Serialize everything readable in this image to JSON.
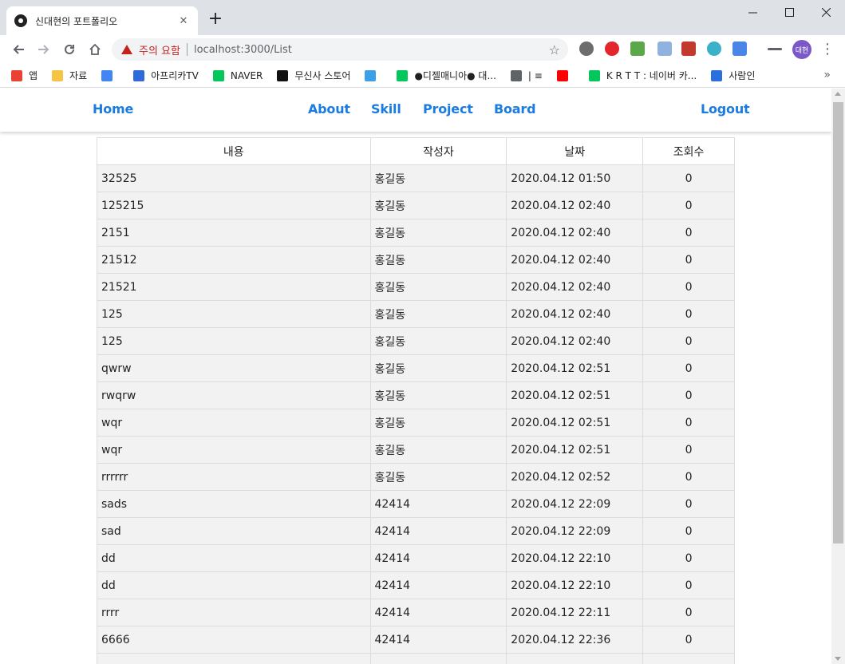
{
  "browser": {
    "tab_title": "신대현의 포트폴리오",
    "tab_close": "✕",
    "new_tab": "+",
    "security_label": "주의 요함",
    "url": "localhost:3000/List",
    "profile": "대현",
    "bookmarks": [
      {
        "label": "앱",
        "icon": "apps-grid-icon",
        "color": "#e94235"
      },
      {
        "label": "자료",
        "icon": "folder-icon",
        "color": "#f6c445"
      },
      {
        "label": "",
        "icon": "google-icon",
        "color": "#4285f4"
      },
      {
        "label": "아프리카TV",
        "icon": "afreecatv-icon",
        "color": "#2f6bd8"
      },
      {
        "label": "NAVER",
        "icon": "naver-icon",
        "color": "#03c75a"
      },
      {
        "label": "무신사 스토어",
        "icon": "musinsa-icon",
        "color": "#111111"
      },
      {
        "label": "",
        "icon": "ondisk-icon",
        "color": "#3aa0e8"
      },
      {
        "label": "●디젤매니아● 대...",
        "icon": "naver-cafe-icon",
        "color": "#03c75a"
      },
      {
        "label": "| ≡",
        "icon": "globe-icon",
        "color": "#5f6368"
      },
      {
        "label": "",
        "icon": "youtube-icon",
        "color": "#ff0000"
      },
      {
        "label": "K R T T : 네이버 카...",
        "icon": "naver-cafe-icon",
        "color": "#03c75a"
      },
      {
        "label": "사람인",
        "icon": "saramin-icon",
        "color": "#2a6fdb"
      }
    ],
    "more": "»"
  },
  "site": {
    "nav": {
      "home": "Home",
      "about": "About",
      "skill": "Skill",
      "project": "Project",
      "board": "Board",
      "logout": "Logout"
    },
    "accent": "#1a7be0"
  },
  "table": {
    "headers": [
      "내용",
      "작성자",
      "날짜",
      "조회수"
    ],
    "rows": [
      [
        "32525",
        "홍길동",
        "2020.04.12 01:50",
        "0"
      ],
      [
        "125215",
        "홍길동",
        "2020.04.12 02:40",
        "0"
      ],
      [
        "2151",
        "홍길동",
        "2020.04.12 02:40",
        "0"
      ],
      [
        "21512",
        "홍길동",
        "2020.04.12 02:40",
        "0"
      ],
      [
        "21521",
        "홍길동",
        "2020.04.12 02:40",
        "0"
      ],
      [
        "125",
        "홍길동",
        "2020.04.12 02:40",
        "0"
      ],
      [
        "125",
        "홍길동",
        "2020.04.12 02:40",
        "0"
      ],
      [
        "qwrw",
        "홍길동",
        "2020.04.12 02:51",
        "0"
      ],
      [
        "rwqrw",
        "홍길동",
        "2020.04.12 02:51",
        "0"
      ],
      [
        "wqr",
        "홍길동",
        "2020.04.12 02:51",
        "0"
      ],
      [
        "wqr",
        "홍길동",
        "2020.04.12 02:51",
        "0"
      ],
      [
        "rrrrrr",
        "홍길동",
        "2020.04.12 02:52",
        "0"
      ],
      [
        "sads",
        "42414",
        "2020.04.12 22:09",
        "0"
      ],
      [
        "sad",
        "42414",
        "2020.04.12 22:09",
        "0"
      ],
      [
        "dd",
        "42414",
        "2020.04.12 22:10",
        "0"
      ],
      [
        "dd",
        "42414",
        "2020.04.12 22:10",
        "0"
      ],
      [
        "rrrr",
        "42414",
        "2020.04.12 22:11",
        "0"
      ],
      [
        "6666",
        "42414",
        "2020.04.12 22:36",
        "0"
      ],
      [
        "",
        "",
        "",
        ""
      ]
    ]
  }
}
